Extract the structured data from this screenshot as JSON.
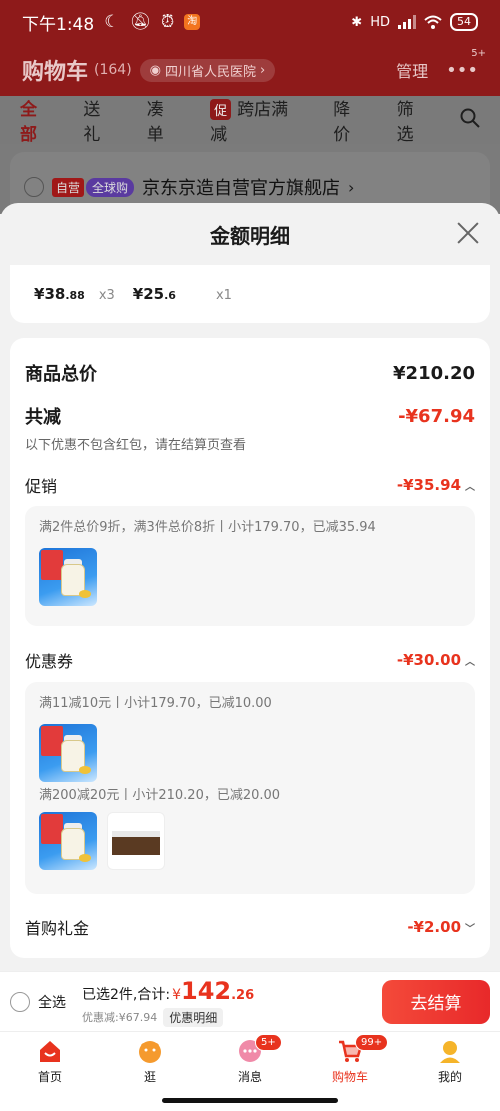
{
  "status_bar": {
    "time": "下午1:48",
    "network": "HD",
    "battery": "54"
  },
  "cart_header": {
    "title": "购物车",
    "count": "(164)",
    "location": "四川省人民医院",
    "manage": "管理",
    "more_badge": "5+"
  },
  "filters": {
    "all": "全部",
    "gift": "送礼",
    "combine": "凑单",
    "promo_icon": "促",
    "cross_store": "跨店满减",
    "price_drop": "降价",
    "filter": "筛选"
  },
  "store": {
    "tag_self": "自营",
    "tag_global": "全球购",
    "name": "京东京造自营官方旗舰店",
    "chevron": "›"
  },
  "sheet": {
    "title": "金额明细",
    "items": [
      {
        "currency": "¥",
        "price_int": "38",
        "price_dec": ".88",
        "qty": "x3"
      },
      {
        "currency": "¥",
        "price_int": "25",
        "price_dec": ".6",
        "qty": "x1"
      }
    ],
    "total_label": "商品总价",
    "total_value": "¥210.20",
    "discount_label": "共减",
    "discount_value": "-¥67.94",
    "discount_note": "以下优惠不包含红包，请在结算页查看",
    "promo": {
      "label": "促销",
      "value": "-¥35.94",
      "desc": "满2件总价9折，满3件总价8折丨小计179.70，已减35.94"
    },
    "coupon": {
      "label": "优惠券",
      "value": "-¥30.00",
      "desc1": "满11减10元丨小计179.70，已减10.00",
      "desc2": "满200减20元丨小计210.20，已减20.00"
    },
    "first_gift": {
      "label": "首购礼金",
      "value": "-¥2.00"
    }
  },
  "bottom_bar": {
    "select_all": "全选",
    "selected_text": "已选2件,合计:",
    "currency": "¥",
    "total_int": "142",
    "total_dec": ".26",
    "discount_text": "优惠减:¥67.94",
    "detail_chip": "优惠明细",
    "checkout": "去结算"
  },
  "tabbar": {
    "items": [
      {
        "label": "首页"
      },
      {
        "label": "逛"
      },
      {
        "label": "消息",
        "badge": "5+"
      },
      {
        "label": "购物车",
        "badge": "99+"
      },
      {
        "label": "我的"
      }
    ]
  },
  "colors": {
    "accent": "#e8331e",
    "header_bg": "#8e1a1a"
  }
}
